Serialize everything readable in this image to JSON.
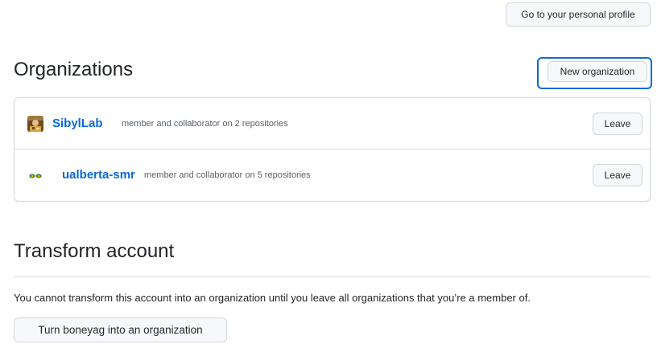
{
  "header": {
    "profile_button_label": "Go to your personal profile"
  },
  "organizations_section": {
    "title": "Organizations",
    "new_button_label": "New organization",
    "items": [
      {
        "name": "SibylLab",
        "description": "member and collaborator on 2 repositories",
        "leave_label": "Leave",
        "avatar_icon": "sibyllab-avatar-icon"
      },
      {
        "name": "ualberta-smr",
        "description": "member and collaborator on 5 repositories",
        "leave_label": "Leave",
        "avatar_icon": "ualberta-smr-avatar-icon"
      }
    ]
  },
  "transform_section": {
    "title": "Transform account",
    "description": "You cannot transform this account into an organization until you leave all organizations that you’re a member of.",
    "button_label": "Turn boneyag into an organization"
  },
  "colors": {
    "link": "#0969da",
    "focus_ring": "#0969da",
    "button_bg": "#f6f8fa",
    "border": "#d0d7de"
  }
}
